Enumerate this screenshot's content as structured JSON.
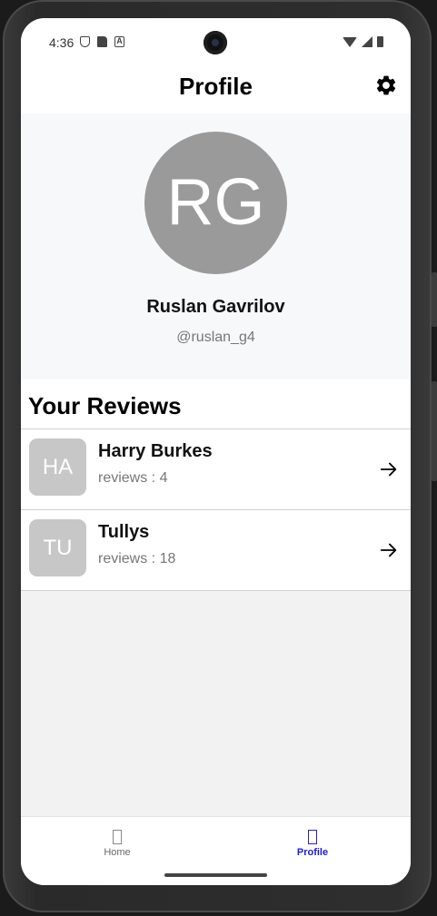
{
  "status_bar": {
    "time": "4:36"
  },
  "header": {
    "title": "Profile"
  },
  "profile": {
    "initials": "RG",
    "name": "Ruslan Gavrilov",
    "handle": "@ruslan_g4"
  },
  "reviews": {
    "title": "Your Reviews",
    "items": [
      {
        "initials": "HA",
        "name": "Harry Burkes",
        "count_text": "reviews : 4"
      },
      {
        "initials": "TU",
        "name": "Tullys",
        "count_text": "reviews : 18"
      }
    ]
  },
  "nav": {
    "items": [
      {
        "label": "Home",
        "active": false
      },
      {
        "label": "Profile",
        "active": true
      }
    ]
  },
  "colors": {
    "accent": "#1b1bd4",
    "avatar_bg": "#9a9a9a",
    "review_avatar_bg": "#c7c7c7"
  }
}
